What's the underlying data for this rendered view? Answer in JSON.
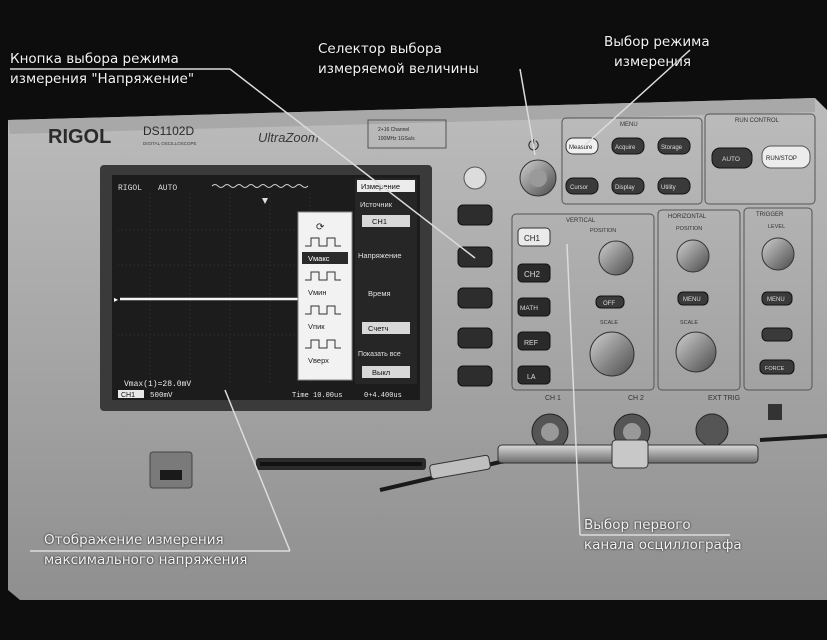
{
  "callouts": {
    "voltage_button": [
      "Кнопка выбора режима",
      "измерения \"Напряжение\""
    ],
    "quantity_selector": [
      "Селектор выбора",
      "измеряемой величины"
    ],
    "measure_mode": [
      "Выбор режима",
      "измерения"
    ],
    "max_voltage_display": [
      "Отображение измерения",
      "максимального напряжения"
    ],
    "channel1_select": [
      "Выбор первого",
      "канала осциллографа"
    ]
  },
  "device": {
    "brand": "RIGOL",
    "model": "DS1102D",
    "model_sub": "DIGITAL OSCILLOSCOPE",
    "series": "UltraZoom",
    "spec": [
      "2+16 Channel",
      "100MHz 1GSa/s"
    ]
  },
  "screen": {
    "status_left": "RIGOL",
    "status_mode": "AUTO",
    "menu": {
      "title": "Измерение",
      "source_label": "Источник",
      "source_value": "CH1",
      "voltage": "Напряжение",
      "time": "Время",
      "counter": "Счетч",
      "show_all_label": "Показать все",
      "show_all_value": "Выкл"
    },
    "popup": [
      "Vмакс",
      "Vмин",
      "Vпик",
      "Vверх"
    ],
    "readout": "Vmax(1)=28.0mV",
    "bottom_ch": "CH1",
    "bottom_scale": "500mV",
    "bottom_time": "Time 10.00us",
    "bottom_trig": "0+4.400us"
  },
  "panel": {
    "sections": [
      "MENU",
      "RUN CONTROL",
      "VERTICAL",
      "HORIZONTAL",
      "TRIGGER"
    ],
    "menu_buttons": [
      "Measure",
      "Acquire",
      "Storage",
      "Cursor",
      "Display",
      "Utility"
    ],
    "run_buttons": [
      "AUTO",
      "RUN/STOP"
    ],
    "channel_buttons": [
      "CH1",
      "CH2",
      "MATH",
      "REF",
      "LA"
    ],
    "off_button": "OFF",
    "menu_button": "MENU",
    "force_button": "FORCE",
    "position_label": "POSITION",
    "scale_label": "SCALE",
    "level_label": "LEVEL",
    "inputs": [
      "CH 1",
      "CH 2",
      "EXT TRIG"
    ]
  }
}
